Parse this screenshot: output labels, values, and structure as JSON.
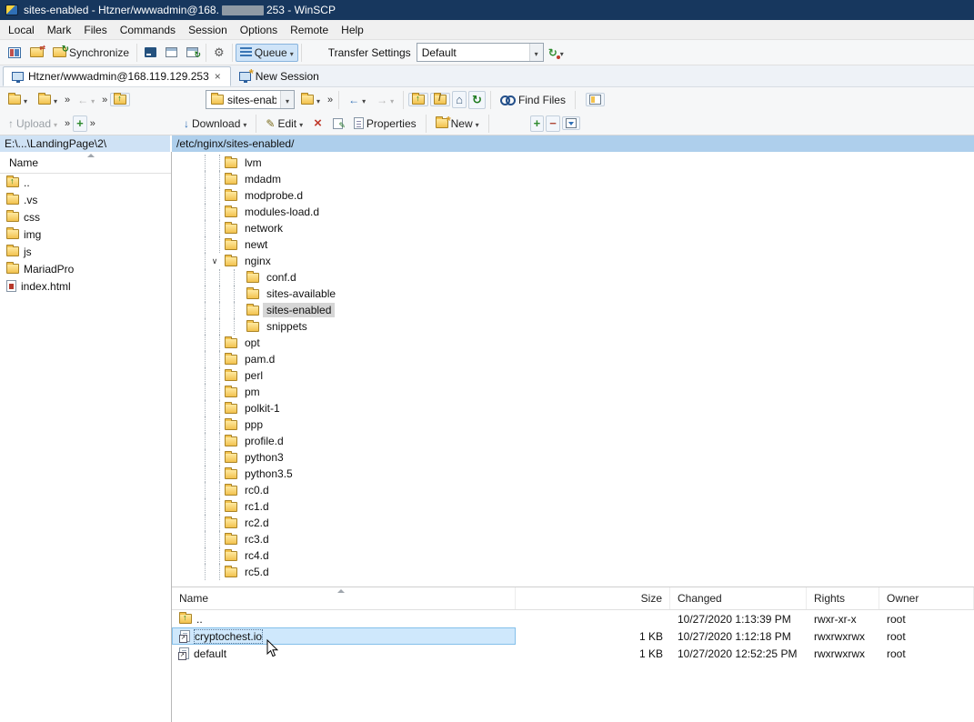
{
  "window": {
    "title_prefix": "sites-enabled - Htzner/wwwadmin@168.",
    "title_suffix": "253 - WinSCP"
  },
  "menu": {
    "items": [
      "Local",
      "Mark",
      "Files",
      "Commands",
      "Session",
      "Options",
      "Remote",
      "Help"
    ]
  },
  "toolbar": {
    "synchronize": "Synchronize",
    "queue": "Queue",
    "transfer_settings_label": "Transfer Settings",
    "transfer_settings_value": "Default"
  },
  "tabs": {
    "session": "Htzner/wwwadmin@168.119.129.253",
    "new_session": "New Session"
  },
  "local_toolbar": {
    "upload": "Upload"
  },
  "remote_toolbar": {
    "address": "sites-enab",
    "find_files": "Find Files"
  },
  "commands": {
    "download": "Download",
    "edit": "Edit",
    "properties": "Properties",
    "new": "New"
  },
  "local_panel": {
    "path": "E:\\...\\LandingPage\\2\\",
    "name_header": "Name",
    "items": [
      {
        "name": "..",
        "icon": "folder-up"
      },
      {
        "name": ".vs",
        "icon": "folder"
      },
      {
        "name": "css",
        "icon": "folder"
      },
      {
        "name": "img",
        "icon": "folder"
      },
      {
        "name": "js",
        "icon": "folder"
      },
      {
        "name": "MariadPro",
        "icon": "folder"
      },
      {
        "name": "index.html",
        "icon": "html"
      }
    ]
  },
  "remote_panel": {
    "path": "/etc/nginx/sites-enabled/",
    "tree": [
      {
        "label": "lvm",
        "level": 0
      },
      {
        "label": "mdadm",
        "level": 0
      },
      {
        "label": "modprobe.d",
        "level": 0
      },
      {
        "label": "modules-load.d",
        "level": 0
      },
      {
        "label": "network",
        "level": 0
      },
      {
        "label": "newt",
        "level": 0
      },
      {
        "label": "nginx",
        "level": 0,
        "expanded": true
      },
      {
        "label": "conf.d",
        "level": 1
      },
      {
        "label": "sites-available",
        "level": 1
      },
      {
        "label": "sites-enabled",
        "level": 1,
        "selected": true
      },
      {
        "label": "snippets",
        "level": 1
      },
      {
        "label": "opt",
        "level": 0
      },
      {
        "label": "pam.d",
        "level": 0
      },
      {
        "label": "perl",
        "level": 0
      },
      {
        "label": "pm",
        "level": 0
      },
      {
        "label": "polkit-1",
        "level": 0
      },
      {
        "label": "ppp",
        "level": 0
      },
      {
        "label": "profile.d",
        "level": 0
      },
      {
        "label": "python3",
        "level": 0
      },
      {
        "label": "python3.5",
        "level": 0
      },
      {
        "label": "rc0.d",
        "level": 0
      },
      {
        "label": "rc1.d",
        "level": 0
      },
      {
        "label": "rc2.d",
        "level": 0
      },
      {
        "label": "rc3.d",
        "level": 0
      },
      {
        "label": "rc4.d",
        "level": 0
      },
      {
        "label": "rc5.d",
        "level": 0
      }
    ],
    "files": {
      "headers": {
        "name": "Name",
        "size": "Size",
        "changed": "Changed",
        "rights": "Rights",
        "owner": "Owner"
      },
      "rows": [
        {
          "name": "..",
          "icon": "folder-up",
          "size": "",
          "changed": "10/27/2020 1:13:39 PM",
          "rights": "rwxr-xr-x",
          "owner": "root"
        },
        {
          "name": "cryptochest.io",
          "icon": "symlink",
          "size": "1 KB",
          "changed": "10/27/2020 1:12:18 PM",
          "rights": "rwxrwxrwx",
          "owner": "root",
          "selected": true
        },
        {
          "name": "default",
          "icon": "symlink",
          "size": "1 KB",
          "changed": "10/27/2020 12:52:25 PM",
          "rights": "rwxrwxrwx",
          "owner": "root"
        }
      ]
    }
  }
}
